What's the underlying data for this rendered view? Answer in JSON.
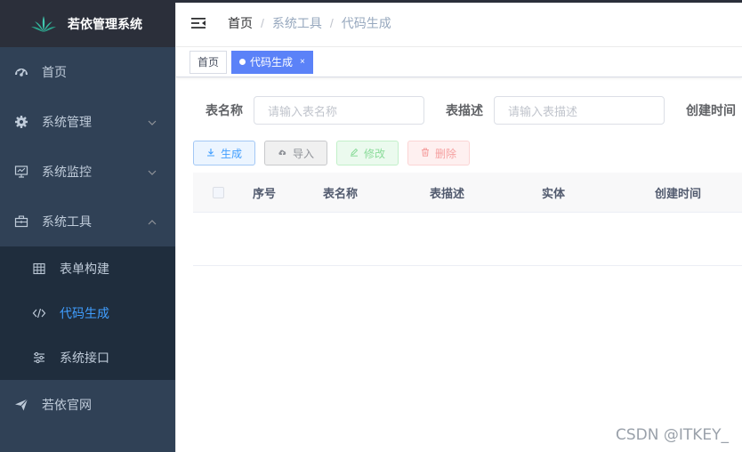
{
  "app": {
    "title": "若依管理系统"
  },
  "sidebar": {
    "items": [
      {
        "label": "首页",
        "icon": "dashboard-icon"
      },
      {
        "label": "系统管理",
        "icon": "gear-icon",
        "expandable": true,
        "expanded": false
      },
      {
        "label": "系统监控",
        "icon": "monitor-icon",
        "expandable": true,
        "expanded": false
      },
      {
        "label": "系统工具",
        "icon": "toolbox-icon",
        "expandable": true,
        "expanded": true,
        "children": [
          {
            "label": "表单构建",
            "icon": "grid-icon"
          },
          {
            "label": "代码生成",
            "icon": "code-icon",
            "active": true
          },
          {
            "label": "系统接口",
            "icon": "sliders-icon"
          }
        ]
      },
      {
        "label": "若依官网",
        "icon": "send-icon"
      }
    ]
  },
  "navbar": {
    "breadcrumb": [
      "首页",
      "系统工具",
      "代码生成"
    ],
    "separator": "/"
  },
  "tags": [
    {
      "label": "首页",
      "active": false
    },
    {
      "label": "代码生成",
      "active": true,
      "close": "×"
    }
  ],
  "search": {
    "table_name_label": "表名称",
    "table_name_placeholder": "请输入表名称",
    "table_desc_label": "表描述",
    "table_desc_placeholder": "请输入表描述",
    "create_time_label": "创建时间"
  },
  "toolbar": {
    "generate": "生成",
    "import": "导入",
    "edit": "修改",
    "delete": "删除"
  },
  "table": {
    "columns": [
      "序号",
      "表名称",
      "表描述",
      "实体",
      "创建时间"
    ]
  },
  "watermark": "CSDN @ITKEY_",
  "colors": {
    "sidebar_bg": "#304156",
    "submenu_bg": "#1f2d3d",
    "active_link": "#409eff",
    "active_tag": "#5b82f8"
  }
}
